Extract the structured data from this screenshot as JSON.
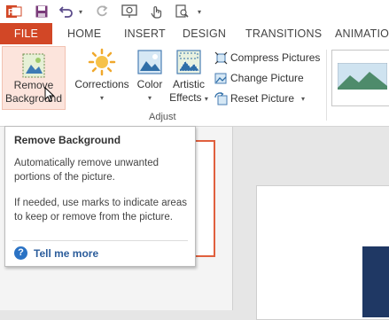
{
  "tabs": {
    "file": "FILE",
    "home": "HOME",
    "insert": "INSERT",
    "design": "DESIGN",
    "transitions": "TRANSITIONS",
    "animations": "ANIMATIONS"
  },
  "ribbon": {
    "remove_background": {
      "line1": "Remove",
      "line2": "Background"
    },
    "corrections": "Corrections",
    "color": "Color",
    "artistic_effects": {
      "line1": "Artistic",
      "line2": "Effects"
    },
    "compress_pictures": "Compress Pictures",
    "change_picture": "Change Picture",
    "reset_picture": "Reset Picture",
    "group_adjust": "Adjust"
  },
  "tooltip": {
    "title": "Remove Background",
    "paragraph1": "Automatically remove unwanted portions of the picture.",
    "paragraph2": "If needed, use marks to indicate areas to keep or remove from the picture.",
    "help_link": "Tell me more",
    "help_icon": "?"
  },
  "colors": {
    "file_tab": "#d24726",
    "accent_orange": "#e0603e",
    "link_blue": "#2c5d9b",
    "slide_dark": "#1f3864"
  },
  "icons": [
    "powerpoint-app-icon",
    "save-icon",
    "undo-icon",
    "redo-icon",
    "slideshow-icon",
    "touch-mode-icon",
    "print-preview-icon"
  ]
}
